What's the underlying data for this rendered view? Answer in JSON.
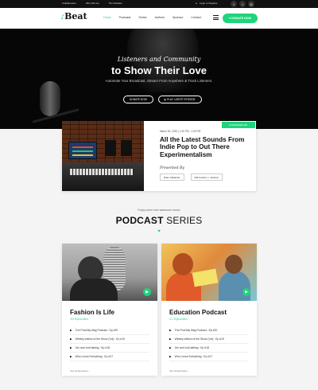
{
  "topbar": {
    "links": [
      "Collaborators",
      "Who We Are",
      "The Podcast"
    ],
    "login": "Login or Register",
    "social": [
      {
        "icon": "facebook-icon",
        "glyph": "f"
      },
      {
        "icon": "twitter-icon",
        "glyph": "t"
      },
      {
        "icon": "instagram-icon",
        "glyph": "◎"
      }
    ]
  },
  "header": {
    "logo": "Beat",
    "nav": [
      "Home",
      "Podcasts",
      "Series",
      "Authors",
      "Sponsor",
      "Contact"
    ],
    "nav_active_index": 0,
    "donate_label": "♥ DONATE NOW"
  },
  "hero": {
    "script": "Listeners and Community",
    "title": "to Show Their Love",
    "subtitle": "Automate Your Broadcast, Stream From Anywhere & Track Listeners.",
    "buttons": [
      "DONATE NOW",
      "▶ PLAY LATEST EPISODE"
    ]
  },
  "featured": {
    "date": "March 26, 2020  |  1:30 PM  -  2:30 PM",
    "badge": "⏺ TRENDING EP.",
    "title": "All the Latest Sounds From Indie Pop to Out There Experimentalism",
    "presented_label": "Presented By",
    "hosts": [
      "Brian Sallander",
      "Will Goldner + Jackson"
    ]
  },
  "series": {
    "enjoy": "Enjoy some new awesome music",
    "title_bold": "PODCAST",
    "title_rest": " SERIES",
    "icon": "♥"
  },
  "cards": [
    {
      "name": "Fashion Is Life",
      "count": "18 Episodes",
      "episodes": [
        "The PoorAlly Mag Podcast : Ep #20",
        "Weekly edition of the Show (Vol) : Ep #19",
        "Jim and Jodi talking : Ep #18",
        "Who Loves Everything : Ep #17"
      ],
      "more": "See All Episodes ›"
    },
    {
      "name": "Education Podcast",
      "count": "22 Episodes",
      "episodes": [
        "The PoorAlly Mag Podcast : Ep #20",
        "Weekly edition of the Show (Vol) : Ep #19",
        "Jim and Jodi talking : Ep #18",
        "Who Loves Everything : Ep #17"
      ],
      "more": "See All Episodes ›"
    }
  ],
  "colors": {
    "accent": "#1fd47c",
    "dark": "#111111"
  }
}
